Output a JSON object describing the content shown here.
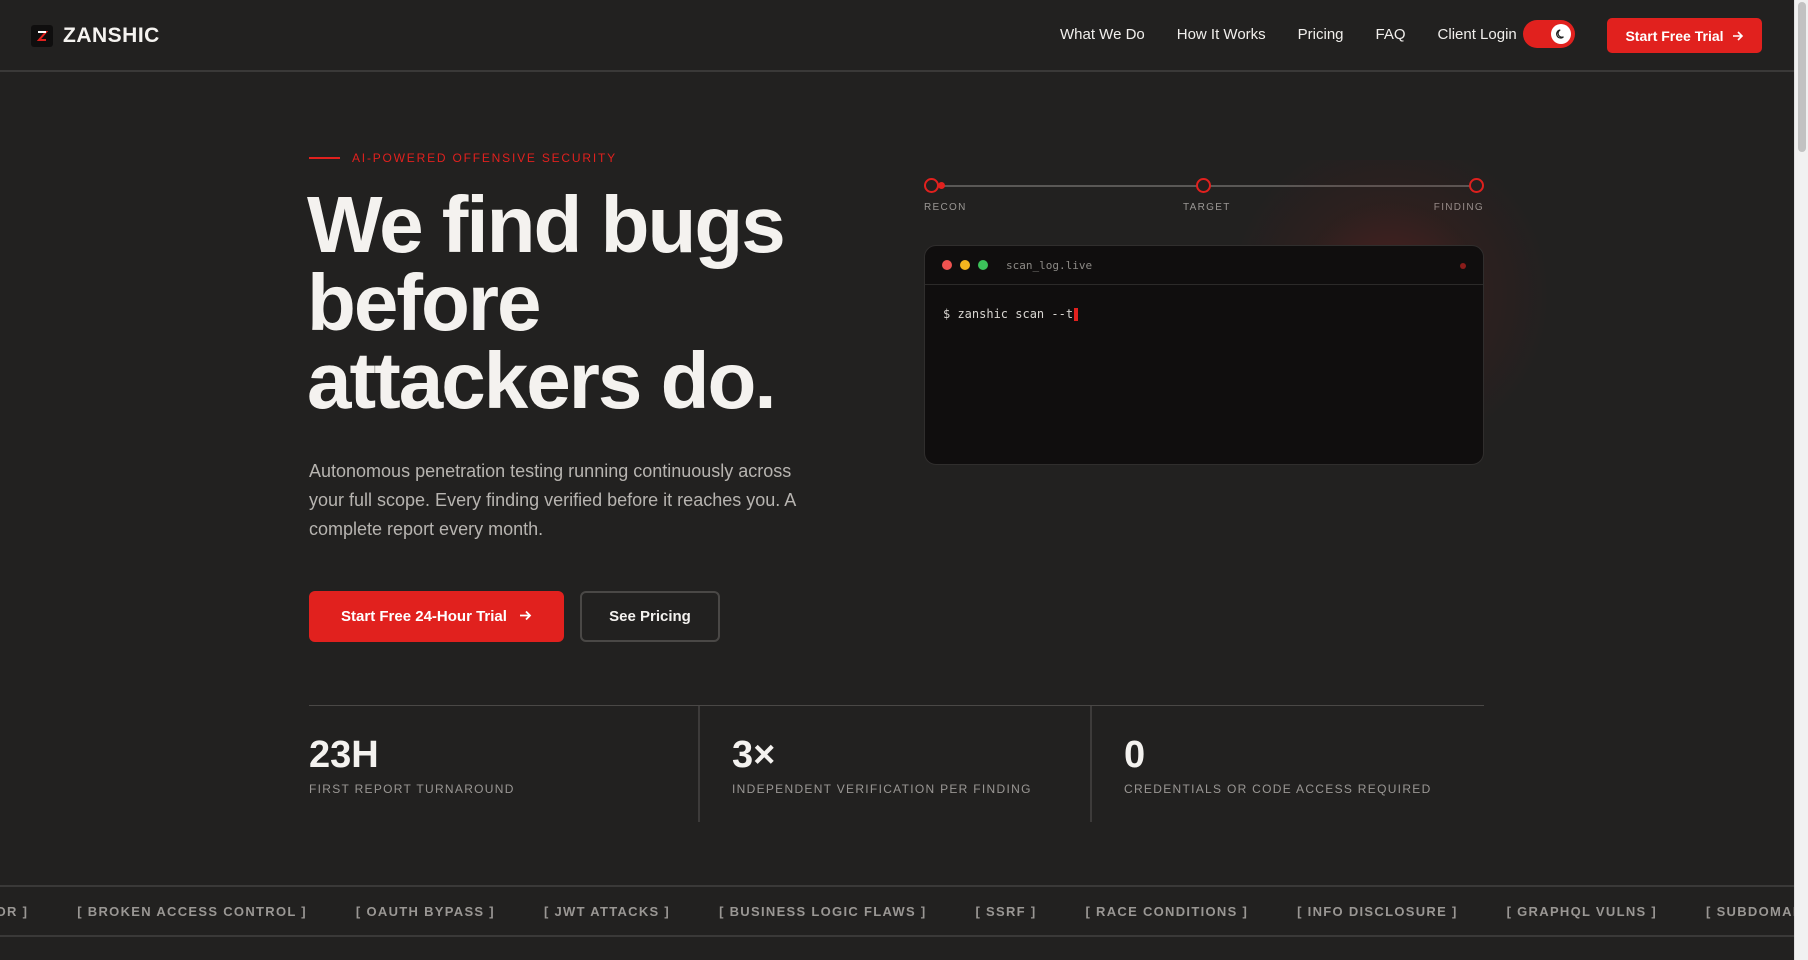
{
  "nav": {
    "brand": "ZANSHIC",
    "links": [
      "What We Do",
      "How It Works",
      "Pricing",
      "FAQ",
      "Client Login"
    ],
    "cta_label": "Start Free Trial",
    "theme_toggle_icon": "moon-icon"
  },
  "hero": {
    "eyebrow": "AI-POWERED OFFENSIVE SECURITY",
    "headline_line1": "We find bugs",
    "headline_line2": "before",
    "headline_line3": "attackers do.",
    "subtext": "Autonomous penetration testing running continuously across your full scope. Every finding verified before it reaches you. A complete report every month.",
    "primary_cta": "Start Free 24-Hour Trial",
    "secondary_cta": "See Pricing"
  },
  "timeline": {
    "steps": [
      "RECON",
      "TARGET",
      "FINDING"
    ]
  },
  "terminal": {
    "title": "scan_log.live",
    "command": "$ zanshic scan --t"
  },
  "stats": [
    {
      "value": "23H",
      "label": "FIRST REPORT TURNAROUND"
    },
    {
      "value": "3×",
      "label": "INDEPENDENT VERIFICATION PER FINDING"
    },
    {
      "value": "0",
      "label": "CREDENTIALS OR CODE ACCESS REQUIRED"
    }
  ],
  "marquee": [
    "IDOR ]",
    "[ BROKEN ACCESS CONTROL ]",
    "[ OAUTH BYPASS ]",
    "[ JWT ATTACKS ]",
    "[ BUSINESS LOGIC FLAWS ]",
    "[ SSRF ]",
    "[ RACE CONDITIONS ]",
    "[ INFO DISCLOSURE ]",
    "[ GRAPHQL VULNS ]",
    "[ SUBDOMAIN TAKEOVER ]"
  ],
  "colors": {
    "background": "#222120",
    "accent": "#e1211e",
    "terminal_bg": "#100e0e",
    "muted_text": "#9a9794"
  }
}
